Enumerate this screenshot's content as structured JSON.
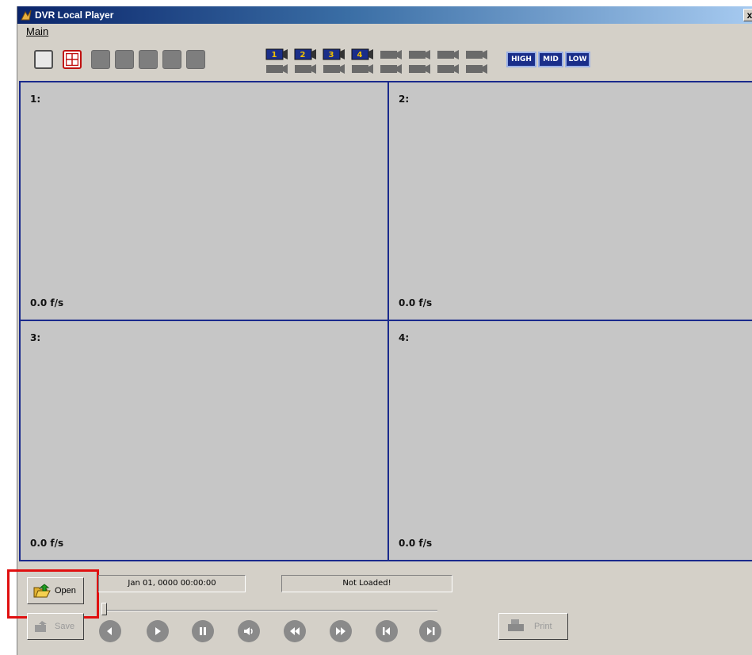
{
  "window": {
    "title": "DVR Local Player",
    "close_glyph": "x"
  },
  "menu": {
    "items": [
      {
        "label": "Main"
      }
    ]
  },
  "toolbar": {
    "split_buttons": [
      "single-split-icon",
      "quad-split-icon",
      "split-disabled",
      "split-disabled",
      "split-disabled",
      "split-disabled",
      "split-disabled"
    ],
    "cameras": [
      {
        "label": "1",
        "active": true
      },
      {
        "label": "2",
        "active": true
      },
      {
        "label": "3",
        "active": true
      },
      {
        "label": "4",
        "active": true
      },
      {
        "label": "",
        "active": false
      },
      {
        "label": "",
        "active": false
      },
      {
        "label": "",
        "active": false
      },
      {
        "label": "",
        "active": false
      }
    ],
    "quality": {
      "high": "HIGH",
      "mid": "MID",
      "low": "LOW"
    }
  },
  "channels": [
    {
      "label": "1:",
      "fps": "0.0 f/s"
    },
    {
      "label": "2:",
      "fps": "0.0 f/s"
    },
    {
      "label": "3:",
      "fps": "0.0 f/s"
    },
    {
      "label": "4:",
      "fps": "0.0 f/s"
    }
  ],
  "controls": {
    "open_label": "Open",
    "save_label": "Save",
    "print_label": "Print",
    "datetime": "Jan 01, 0000  00:00:00",
    "status": "Not Loaded!",
    "playback": [
      "previous-icon",
      "play-icon",
      "pause-icon",
      "sound-icon",
      "rewind-icon",
      "fast-forward-icon",
      "step-back-icon",
      "step-forward-icon"
    ]
  },
  "colors": {
    "title_start": "#0a246a",
    "title_end": "#a6caf0",
    "tile_border": "#1a2a8c",
    "highlight": "#e01010"
  }
}
